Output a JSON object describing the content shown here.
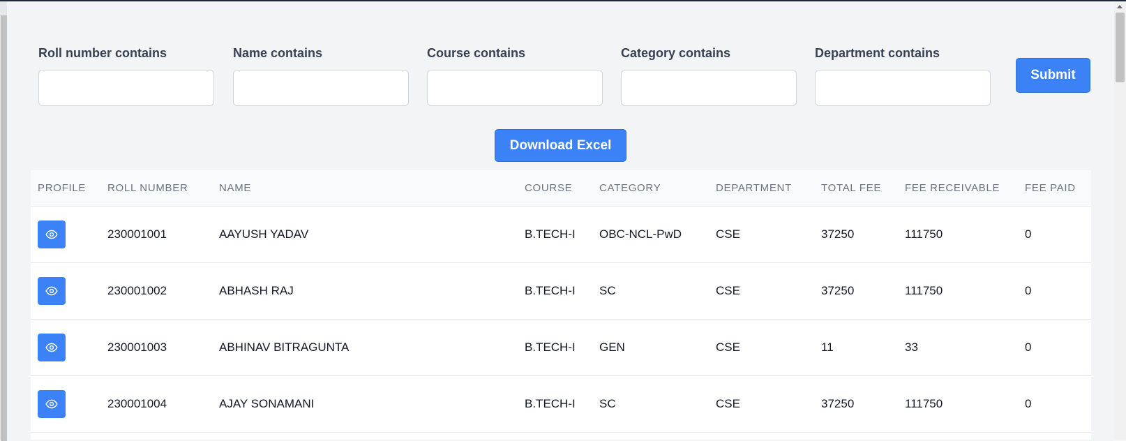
{
  "filters": [
    {
      "label": "Roll number contains",
      "value": "",
      "placeholder": ""
    },
    {
      "label": "Name contains",
      "value": "",
      "placeholder": ""
    },
    {
      "label": "Course contains",
      "value": "",
      "placeholder": ""
    },
    {
      "label": "Category contains",
      "value": "",
      "placeholder": ""
    },
    {
      "label": "Department contains",
      "value": "",
      "placeholder": ""
    }
  ],
  "actions": {
    "submit_label": "Submit",
    "download_label": "Download Excel"
  },
  "table": {
    "headers": [
      "PROFILE",
      "ROLL NUMBER",
      "NAME",
      "COURSE",
      "CATEGORY",
      "DEPARTMENT",
      "TOTAL FEE",
      "FEE RECEIVABLE",
      "FEE PAID"
    ],
    "rows": [
      {
        "roll": "230001001",
        "name": "AAYUSH YADAV",
        "course": "B.TECH-I",
        "category": "OBC-NCL-PwD",
        "department": "CSE",
        "total_fee": "37250",
        "fee_receivable": "111750",
        "fee_paid": "0"
      },
      {
        "roll": "230001002",
        "name": "ABHASH RAJ",
        "course": "B.TECH-I",
        "category": "SC",
        "department": "CSE",
        "total_fee": "37250",
        "fee_receivable": "111750",
        "fee_paid": "0"
      },
      {
        "roll": "230001003",
        "name": "ABHINAV BITRAGUNTA",
        "course": "B.TECH-I",
        "category": "GEN",
        "department": "CSE",
        "total_fee": "11",
        "fee_receivable": "33",
        "fee_paid": "0"
      },
      {
        "roll": "230001004",
        "name": "AJAY SONAMANI",
        "course": "B.TECH-I",
        "category": "SC",
        "department": "CSE",
        "total_fee": "37250",
        "fee_receivable": "111750",
        "fee_paid": "0"
      }
    ]
  },
  "icons": {
    "profile_action": "eye-icon"
  },
  "colors": {
    "accent": "#3b82f6",
    "page_background": "#f3f4f6",
    "header_text": "#6b7280"
  }
}
